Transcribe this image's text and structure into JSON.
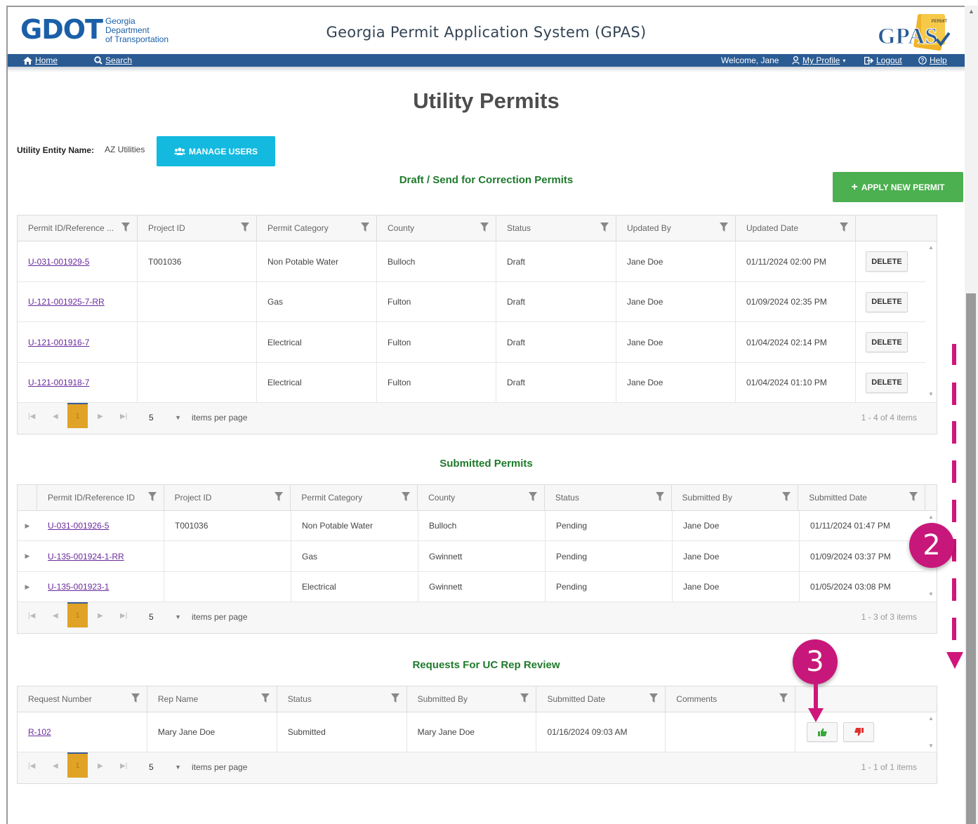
{
  "header": {
    "logo_main": "GDOT",
    "logo_sub": [
      "Georgia",
      "Department",
      "of Transportation"
    ],
    "title": "Georgia Permit Application System (GPAS)",
    "gpas_logo": "GPAS",
    "gpas_tag": "PERMIT"
  },
  "nav": {
    "home": "Home",
    "search": "Search",
    "welcome": "Welcome, Jane",
    "profile": "My Profile",
    "logout": "Logout",
    "help": "Help"
  },
  "page": {
    "title": "Utility Permits",
    "entity_label": "Utility Entity Name:",
    "entity_value": "AZ Utilities",
    "manage_users": "MANAGE USERS",
    "apply_new_permit": "APPLY NEW PERMIT"
  },
  "drafts": {
    "title": "Draft / Send for Correction Permits",
    "columns": [
      "Permit ID/Reference ...",
      "Project ID",
      "Permit Category",
      "County",
      "Status",
      "Updated By",
      "Updated Date"
    ],
    "delete_label": "DELETE",
    "rows": [
      [
        "U-031-001929-5",
        "T001036",
        "Non Potable Water",
        "Bulloch",
        "Draft",
        "Jane Doe",
        "01/11/2024 02:00 PM"
      ],
      [
        "U-121-001925-7-RR",
        "",
        "Gas",
        "Fulton",
        "Draft",
        "Jane Doe",
        "01/09/2024 02:35 PM"
      ],
      [
        "U-121-001916-7",
        "",
        "Electrical",
        "Fulton",
        "Draft",
        "Jane Doe",
        "01/04/2024 02:14 PM"
      ],
      [
        "U-121-001918-7",
        "",
        "Electrical",
        "Fulton",
        "Draft",
        "Jane Doe",
        "01/04/2024 01:10 PM"
      ]
    ],
    "pager": {
      "page": "1",
      "page_size": "5",
      "items_per_page": "items per page",
      "info": "1 - 4 of 4 items"
    }
  },
  "submitted": {
    "title": "Submitted Permits",
    "columns": [
      "Permit ID/Reference ID",
      "Project ID",
      "Permit Category",
      "County",
      "Status",
      "Submitted By",
      "Submitted Date"
    ],
    "rows": [
      [
        "U-031-001926-5",
        "T001036",
        "Non Potable Water",
        "Bulloch",
        "Pending",
        "Jane Doe",
        "01/11/2024 01:47 PM"
      ],
      [
        "U-135-001924-1-RR",
        "",
        "Gas",
        "Gwinnett",
        "Pending",
        "Jane Doe",
        "01/09/2024 03:37 PM"
      ],
      [
        "U-135-001923-1",
        "",
        "Electrical",
        "Gwinnett",
        "Pending",
        "Jane Doe",
        "01/05/2024 03:08 PM"
      ]
    ],
    "pager": {
      "page": "1",
      "page_size": "5",
      "items_per_page": "items per page",
      "info": "1 - 3 of 3 items"
    }
  },
  "requests": {
    "title": "Requests For UC Rep Review",
    "columns": [
      "Request Number",
      "Rep Name",
      "Status",
      "Submitted By",
      "Submitted Date",
      "Comments"
    ],
    "rows": [
      [
        "R-102",
        "Mary Jane Doe",
        "Submitted",
        "Mary Jane Doe",
        "01/16/2024 09:03 AM",
        ""
      ]
    ],
    "pager": {
      "page": "1",
      "page_size": "5",
      "items_per_page": "items per page",
      "info": "1 - 1 of 1 items"
    }
  },
  "callouts": {
    "step2": "2",
    "step3": "3"
  },
  "colors": {
    "nav": "#2a5b93",
    "manage": "#13b9df",
    "apply": "#4caf50",
    "section_title": "#1f7a2c",
    "callout": "#c8177a",
    "pager_active": "#e0a326",
    "link": "#6a2a9c"
  }
}
